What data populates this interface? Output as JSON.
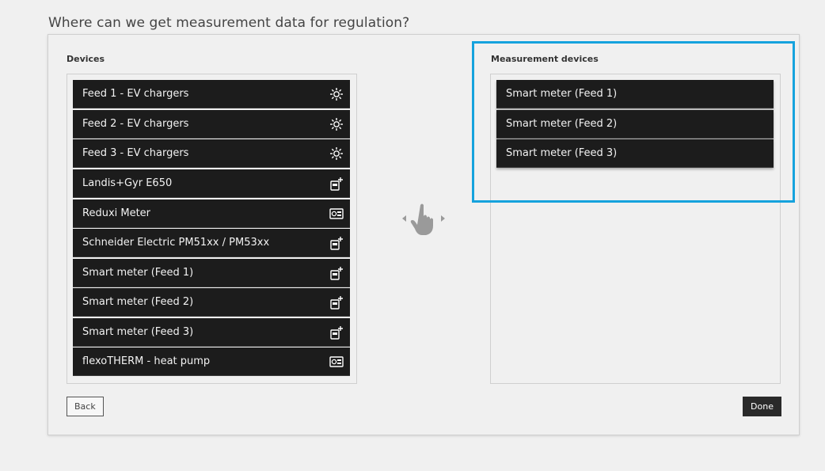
{
  "page": {
    "title": "Where can we get measurement data for regulation?"
  },
  "devices": {
    "label": "Devices",
    "items": [
      {
        "label": "Feed 1 - EV chargers",
        "icon": "sun-icon"
      },
      {
        "label": "Feed 2 - EV chargers",
        "icon": "sun-icon"
      },
      {
        "label": "Feed 3 - EV chargers",
        "icon": "sun-icon"
      },
      {
        "label": "Landis+Gyr E650",
        "icon": "meter-plus-icon"
      },
      {
        "label": "Reduxi Meter",
        "icon": "device-panel-icon"
      },
      {
        "label": "Schneider Electric PM51xx / PM53xx",
        "icon": "meter-plus-icon"
      },
      {
        "label": "Smart meter (Feed 1)",
        "icon": "meter-plus-icon"
      },
      {
        "label": "Smart meter (Feed 2)",
        "icon": "meter-plus-icon"
      },
      {
        "label": "Smart meter (Feed 3)",
        "icon": "meter-plus-icon"
      },
      {
        "label": "flexoTHERM - heat pump",
        "icon": "device-panel-icon"
      }
    ]
  },
  "measurement": {
    "label": "Measurement devices",
    "items": [
      {
        "label": "Smart meter (Feed 1)"
      },
      {
        "label": "Smart meter (Feed 2)"
      },
      {
        "label": "Smart meter (Feed 3)"
      }
    ]
  },
  "hint": {
    "icon": "drag-hand-icon"
  },
  "buttons": {
    "back": "Back",
    "done": "Done"
  },
  "colors": {
    "highlight": "#15a2dd",
    "item_bg": "#1c1c1c"
  }
}
